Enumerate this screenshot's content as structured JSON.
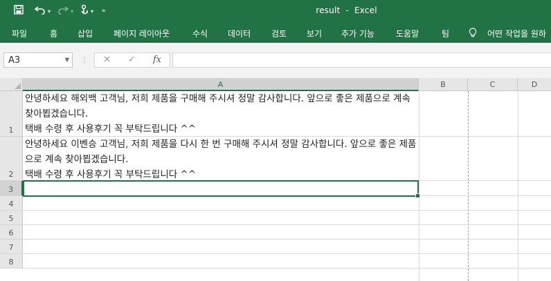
{
  "window": {
    "file_name": "result",
    "separator": "-",
    "app_name": "Excel"
  },
  "qat": {
    "save_icon": "save-icon",
    "undo_icon": "undo-icon",
    "redo_icon": "redo-icon",
    "touch_icon": "touch-mode-icon",
    "customize_icon": "customize-qat-icon"
  },
  "ribbon": {
    "tabs": [
      "파일",
      "홈",
      "삽입",
      "페이지 레이아웃",
      "수식",
      "데이터",
      "검토",
      "보기",
      "추가 기능",
      "도움말",
      "팀"
    ],
    "tell_me": "어떤 작업을 원하"
  },
  "formula_bar": {
    "name_box": "A3",
    "cancel_symbol": "✕",
    "enter_symbol": "✓",
    "fx_label": "fx",
    "value": ""
  },
  "sheet": {
    "columns": [
      "A",
      "B",
      "C",
      "D"
    ],
    "selected_column": "A",
    "rows": [
      "1",
      "2",
      "3",
      "4",
      "5",
      "6",
      "7",
      "8"
    ],
    "selected_row": "3",
    "cells": {
      "A1": "안녕하세요 해외백 고객님, 저희 제품을 구매해 주시셔 정말 감사합니다. 앞으로 좋은 제품으로 계속 찾아뵙겠습니다.\n택배 수령 후 사용후기 꼭 부탁드립니다 ^^",
      "A2": "안녕하세요 이벤승 고객님, 저희 제품을 다시 한 번 구매해 주시셔 정말 감사합니다. 앞으로 좋은 제품으로 계속 찾아뵙겠습니다.\n택배 수령 후 사용후기 꼭 부탁드립니다 ^^"
    }
  },
  "colors": {
    "accent": "#217346",
    "header_bg": "#e6e6e6"
  }
}
